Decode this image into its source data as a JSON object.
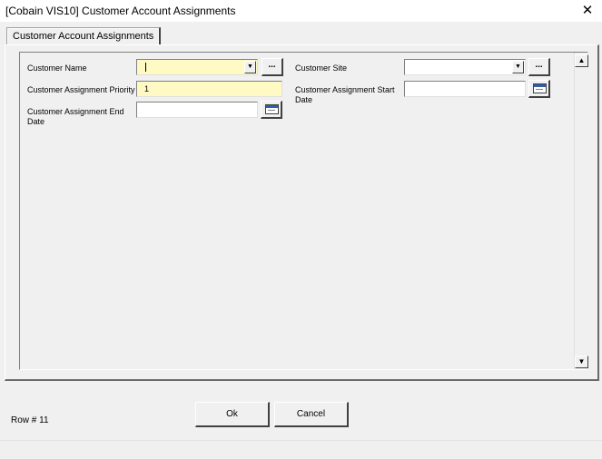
{
  "window": {
    "title": "[Cobain VIS10] Customer Account Assignments",
    "close_icon": "close-icon"
  },
  "tabs": [
    {
      "label": "Customer Account Assignments",
      "selected": true
    }
  ],
  "form": {
    "customer_name": {
      "label": "Customer Name",
      "value": "",
      "ellipsis": "..."
    },
    "customer_site": {
      "label": "Customer Site",
      "value": "",
      "ellipsis": "..."
    },
    "assignment_priority": {
      "label": "Customer Assignment Priority",
      "value": "1"
    },
    "assignment_start_date": {
      "label": "Customer Assignment Start Date",
      "value": ""
    },
    "assignment_end_date": {
      "label": "Customer Assignment End Date",
      "value": ""
    }
  },
  "colors": {
    "required_field": "#fff9c4",
    "background": "#f0f0f0"
  },
  "footer": {
    "row_status": "Row # 11",
    "ok_label": "Ok",
    "cancel_label": "Cancel"
  }
}
